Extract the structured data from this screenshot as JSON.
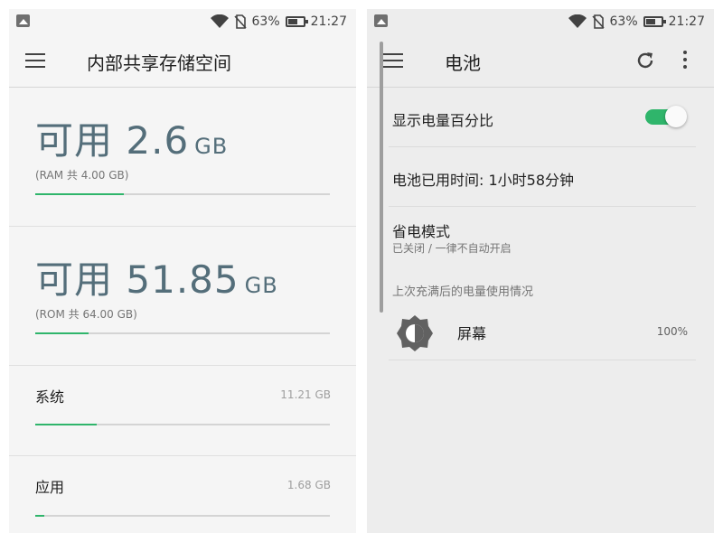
{
  "status_bar": {
    "battery_percent": "63%",
    "time": "21:27"
  },
  "left": {
    "title": "内部共享存储空间",
    "ram": {
      "label": "可用",
      "value": "2.6",
      "unit": "GB",
      "detail": "(RAM 共 4.00 GB)",
      "usage_fraction": 0.3
    },
    "rom": {
      "label": "可用",
      "value": "51.85",
      "unit": "GB",
      "detail": "(ROM 共 64.00 GB)",
      "usage_fraction": 0.18
    },
    "rows": [
      {
        "label": "系统",
        "value": "11.21 GB",
        "usage_fraction": 0.21
      },
      {
        "label": "应用",
        "value": "1.68 GB",
        "usage_fraction": 0.03
      }
    ]
  },
  "right": {
    "title": "电池",
    "show_percent": {
      "label": "显示电量百分比",
      "enabled": true
    },
    "usage_time": "电池已用时间: 1小时58分钟",
    "power_saving": {
      "label": "省电模式",
      "status": "已关闭 / 一律不自动开启"
    },
    "section_header": "上次充满后的电量使用情况",
    "usage_items": [
      {
        "label": "屏幕",
        "percent": "100%"
      }
    ]
  },
  "colors": {
    "accent_green": "#2fb56b",
    "memory_text": "#546e7a"
  },
  "icons": [
    "menu-icon",
    "wifi-icon",
    "no-sim-icon",
    "battery-icon",
    "refresh-icon",
    "more-vert-icon",
    "brightness-icon",
    "gallery-icon"
  ]
}
